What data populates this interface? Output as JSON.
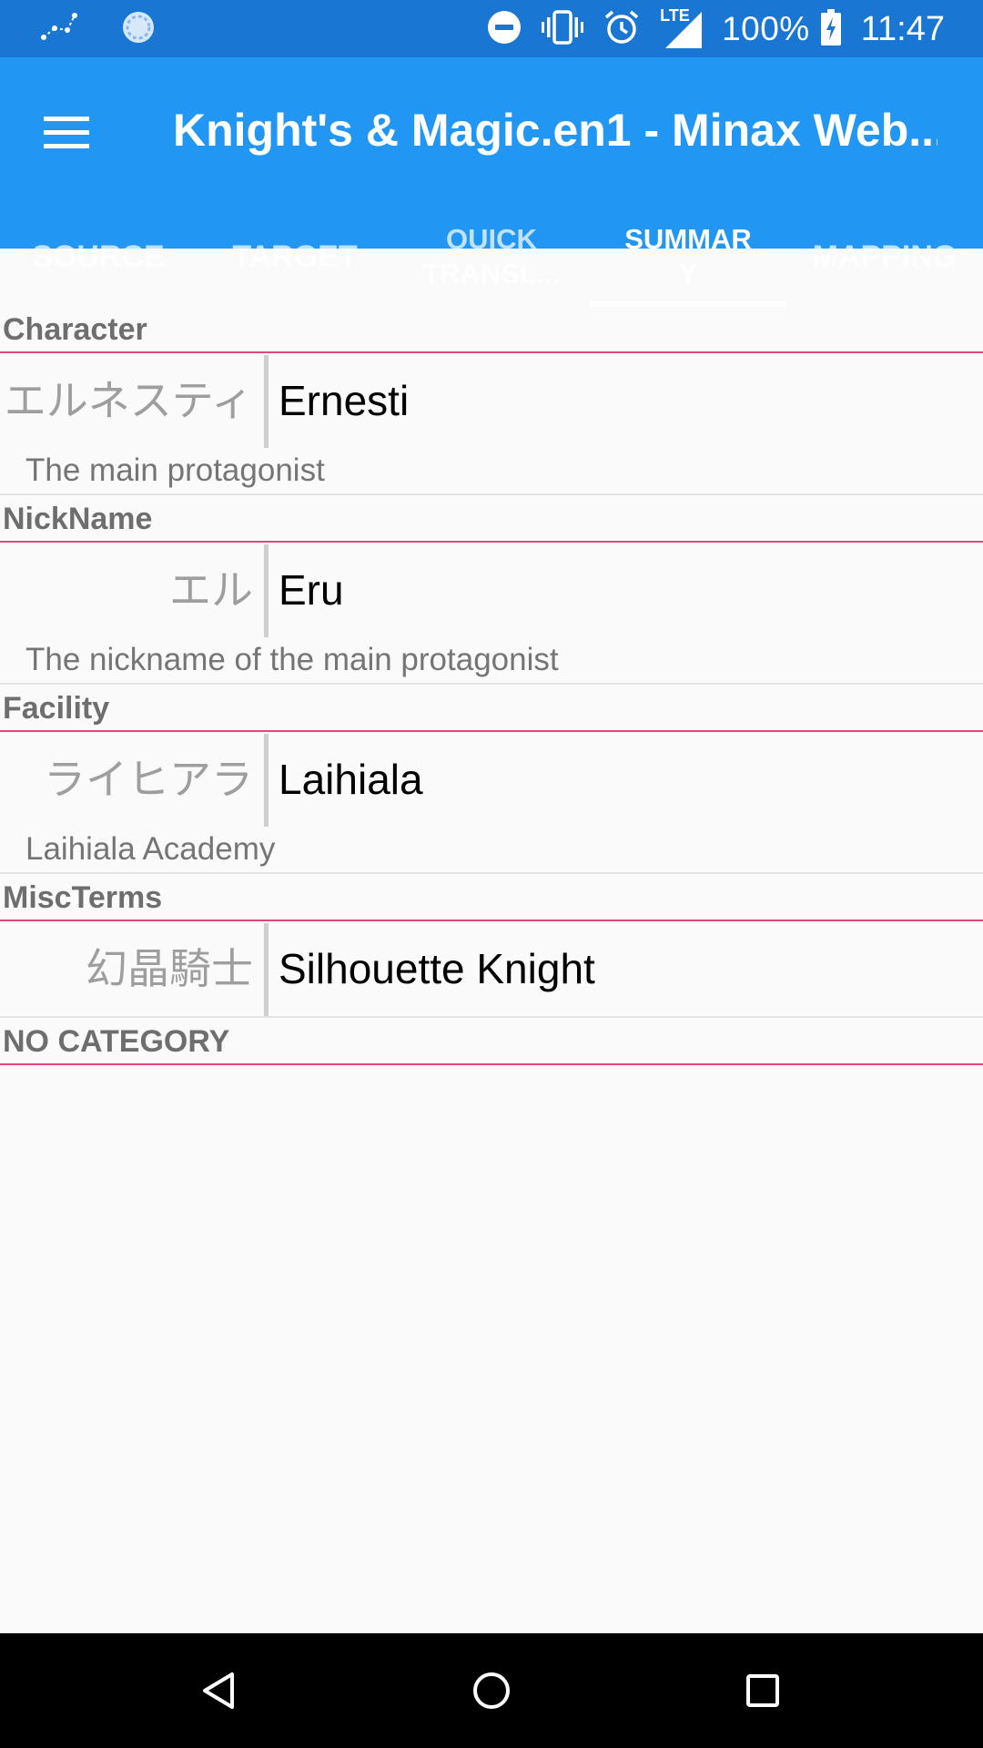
{
  "status_bar": {
    "battery": "100%",
    "time": "11:47",
    "network": "LTE",
    "icons": [
      "constellation-icon",
      "sync-icon",
      "do-not-disturb-icon",
      "vibrate-icon",
      "alarm-icon",
      "signal-icon",
      "battery-charging-icon"
    ]
  },
  "app_bar": {
    "title": "Knight's & Magic.en1 - Minax Web...",
    "menu_icon": "hamburger-menu-icon"
  },
  "tabs": [
    {
      "label": "SOURCE",
      "active": false
    },
    {
      "label": "TARGET",
      "active": false
    },
    {
      "label": "QUICK\nTRANSL...",
      "active": false
    },
    {
      "label": "SUMMAR\nY",
      "active": true
    },
    {
      "label": "MAPPING",
      "active": false
    }
  ],
  "groups": [
    {
      "category": "Character",
      "source": "エルネスティ",
      "target": "Ernesti",
      "comment": "The main protagonist"
    },
    {
      "category": "NickName",
      "source": "エル",
      "target": "Eru",
      "comment": "The nickname of the main protagonist"
    },
    {
      "category": "Facility",
      "source": "ライヒアラ",
      "target": "Laihiala",
      "comment": "Laihiala Academy"
    },
    {
      "category": "MiscTerms",
      "source": "幻晶騎士",
      "target": "Silhouette Knight",
      "comment": ""
    }
  ],
  "no_category_label": "NO CATEGORY",
  "colors": {
    "status_bar": "#1976d2",
    "app_bar": "#2196f3",
    "category_divider": "#e2467a",
    "nav_bar": "#000000"
  }
}
